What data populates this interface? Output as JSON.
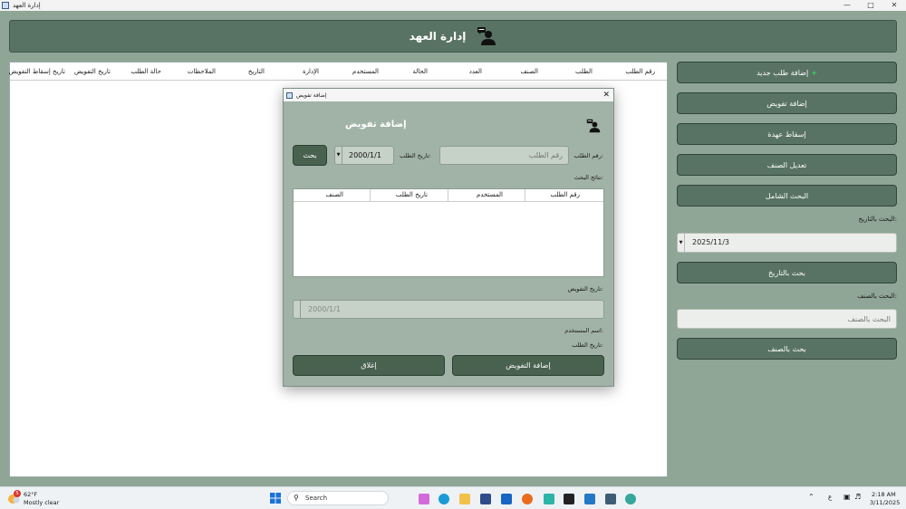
{
  "window": {
    "title": "إدارة العهد"
  },
  "banner": {
    "title": "إدارة العهد",
    "icon": "user-chat-icon"
  },
  "table": {
    "columns": [
      "رقم الطلب",
      "الطلب",
      "الصنف",
      "العدد",
      "الحالة",
      "المستخدم",
      "الإدارة",
      "التاريخ",
      "الملاحظات",
      "حالة الطلب",
      "تاريخ التفويض",
      "تاريخ إسقاط التفويض"
    ]
  },
  "right_panel": {
    "add_request": "إضافة طلب جديد",
    "add_delegation": "إضافة تفويض",
    "drop_custody": "إسقاط عهدة",
    "edit_item": "تعديل الصنف",
    "full_search": "البحث الشامل",
    "search_by_date_label": "البحث بالتاريخ:",
    "date_value": "2025/11/3",
    "search_by_date_btn": "بحث بالتاريخ",
    "search_by_item_label": "البحث بالصنف:",
    "search_by_item_placeholder": "البحث بالصنف",
    "search_by_item_btn": "بحث بالصنف"
  },
  "dialog": {
    "title": "إضافة تفويض",
    "heading": "إضافة تفويض",
    "request_number_label": "رقم الطلب:",
    "request_number_placeholder": "رقم الطلب",
    "request_date_label": "تاريخ الطلب:",
    "request_date_value": "2000/1/1",
    "search_btn": "بحث",
    "results_label": "نتائج البحث:",
    "results_columns": [
      "رقم الطلب",
      "المستخدم",
      "تاريخ الطلب",
      "الصنف"
    ],
    "delegation_date_label": "تاريخ التفويض:",
    "delegation_date_value": "2000/1/1",
    "user_name_label": "اسم المستخدم:",
    "request_date_label2": "تاريخ الطلب:",
    "add_delegation_btn": "إضافة التفويض",
    "close_btn": "إغلاق"
  },
  "taskbar": {
    "weather_temp": "62°F",
    "weather_desc": "Mostly clear",
    "weather_badge": "5",
    "search_placeholder": "Search",
    "language": "ع",
    "time": "2:18 AM",
    "date": "3/11/2025"
  }
}
